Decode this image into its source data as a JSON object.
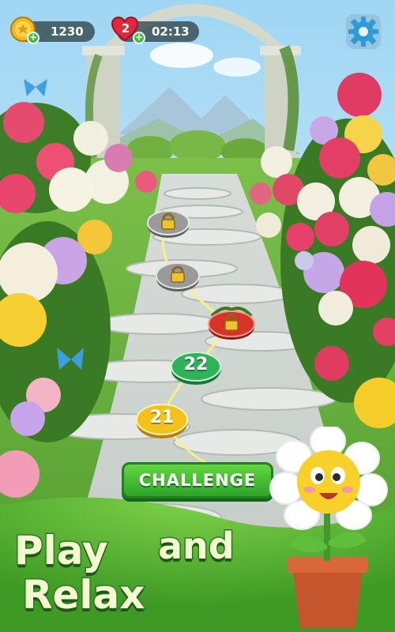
{
  "hud": {
    "coins": "1230",
    "lives": "2",
    "timer": "02:13",
    "plus": "+"
  },
  "levels": [
    {
      "label": "21",
      "state": "current",
      "color": "#f2c21a"
    },
    {
      "label": "22",
      "state": "next",
      "color": "#2fb25a"
    },
    {
      "label": "",
      "state": "locked-challenge",
      "color": "#d8332b"
    },
    {
      "label": "",
      "state": "locked",
      "color": "#8a8a8a"
    },
    {
      "label": "",
      "state": "locked",
      "color": "#8a8a8a"
    }
  ],
  "challenge_label": "CHALLENGE",
  "tagline": {
    "line1a": "Play",
    "line1b": "and",
    "line2": "Relax"
  },
  "icons": [
    "coin-icon",
    "heart-icon",
    "gear-icon",
    "padlock-icon",
    "flower-mascot-icon",
    "butterfly-icon"
  ]
}
